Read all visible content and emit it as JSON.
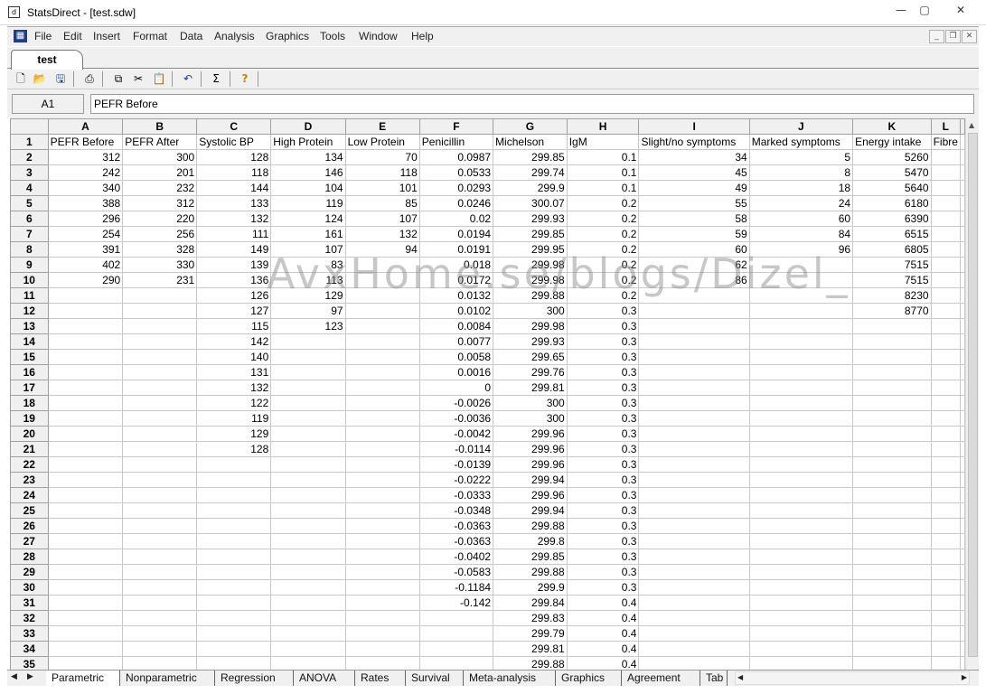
{
  "window": {
    "title": "StatsDirect - [test.sdw]",
    "minimize": "—",
    "maximize": "▢",
    "close": "✕"
  },
  "menu": {
    "items": [
      "File",
      "Edit",
      "Insert",
      "Format",
      "Data",
      "Analysis",
      "Graphics",
      "Tools",
      "Window",
      "Help"
    ]
  },
  "doc_tab": "test",
  "formula": {
    "cell_ref": "A1",
    "content": "PEFR Before"
  },
  "grid": {
    "columns": [
      "A",
      "B",
      "C",
      "D",
      "E",
      "F",
      "G",
      "H",
      "I",
      "J",
      "K",
      "L"
    ],
    "headers": [
      "PEFR Before",
      "PEFR After",
      "Systolic BP",
      "High Protein",
      "Low Protein",
      "Penicillin",
      "Michelson",
      "IgM",
      "Slight/no symptoms",
      "Marked symptoms",
      "Energy intake",
      "Fibre"
    ],
    "rows": [
      [
        "312",
        "300",
        "128",
        "134",
        "70",
        "0.0987",
        "299.85",
        "0.1",
        "34",
        "5",
        "5260",
        ""
      ],
      [
        "242",
        "201",
        "118",
        "146",
        "118",
        "0.0533",
        "299.74",
        "0.1",
        "45",
        "8",
        "5470",
        ""
      ],
      [
        "340",
        "232",
        "144",
        "104",
        "101",
        "0.0293",
        "299.9",
        "0.1",
        "49",
        "18",
        "5640",
        ""
      ],
      [
        "388",
        "312",
        "133",
        "119",
        "85",
        "0.0246",
        "300.07",
        "0.2",
        "55",
        "24",
        "6180",
        ""
      ],
      [
        "296",
        "220",
        "132",
        "124",
        "107",
        "0.02",
        "299.93",
        "0.2",
        "58",
        "60",
        "6390",
        ""
      ],
      [
        "254",
        "256",
        "111",
        "161",
        "132",
        "0.0194",
        "299.85",
        "0.2",
        "59",
        "84",
        "6515",
        ""
      ],
      [
        "391",
        "328",
        "149",
        "107",
        "94",
        "0.0191",
        "299.95",
        "0.2",
        "60",
        "96",
        "6805",
        ""
      ],
      [
        "402",
        "330",
        "139",
        "83",
        "",
        "0.018",
        "299.98",
        "0.2",
        "62",
        "",
        "7515",
        ""
      ],
      [
        "290",
        "231",
        "136",
        "113",
        "",
        "0.0172",
        "299.98",
        "0.2",
        "86",
        "",
        "7515",
        ""
      ],
      [
        "",
        "",
        "126",
        "129",
        "",
        "0.0132",
        "299.88",
        "0.2",
        "",
        "",
        "8230",
        ""
      ],
      [
        "",
        "",
        "127",
        "97",
        "",
        "0.0102",
        "300",
        "0.3",
        "",
        "",
        "8770",
        ""
      ],
      [
        "",
        "",
        "115",
        "123",
        "",
        "0.0084",
        "299.98",
        "0.3",
        "",
        "",
        "",
        ""
      ],
      [
        "",
        "",
        "142",
        "",
        "",
        "0.0077",
        "299.93",
        "0.3",
        "",
        "",
        "",
        ""
      ],
      [
        "",
        "",
        "140",
        "",
        "",
        "0.0058",
        "299.65",
        "0.3",
        "",
        "",
        "",
        ""
      ],
      [
        "",
        "",
        "131",
        "",
        "",
        "0.0016",
        "299.76",
        "0.3",
        "",
        "",
        "",
        ""
      ],
      [
        "",
        "",
        "132",
        "",
        "",
        "0",
        "299.81",
        "0.3",
        "",
        "",
        "",
        ""
      ],
      [
        "",
        "",
        "122",
        "",
        "",
        "-0.0026",
        "300",
        "0.3",
        "",
        "",
        "",
        ""
      ],
      [
        "",
        "",
        "119",
        "",
        "",
        "-0.0036",
        "300",
        "0.3",
        "",
        "",
        "",
        ""
      ],
      [
        "",
        "",
        "129",
        "",
        "",
        "-0.0042",
        "299.96",
        "0.3",
        "",
        "",
        "",
        ""
      ],
      [
        "",
        "",
        "128",
        "",
        "",
        "-0.0114",
        "299.96",
        "0.3",
        "",
        "",
        "",
        ""
      ],
      [
        "",
        "",
        "",
        "",
        "",
        "-0.0139",
        "299.96",
        "0.3",
        "",
        "",
        "",
        ""
      ],
      [
        "",
        "",
        "",
        "",
        "",
        "-0.0222",
        "299.94",
        "0.3",
        "",
        "",
        "",
        ""
      ],
      [
        "",
        "",
        "",
        "",
        "",
        "-0.0333",
        "299.96",
        "0.3",
        "",
        "",
        "",
        ""
      ],
      [
        "",
        "",
        "",
        "",
        "",
        "-0.0348",
        "299.94",
        "0.3",
        "",
        "",
        "",
        ""
      ],
      [
        "",
        "",
        "",
        "",
        "",
        "-0.0363",
        "299.88",
        "0.3",
        "",
        "",
        "",
        ""
      ],
      [
        "",
        "",
        "",
        "",
        "",
        "-0.0363",
        "299.8",
        "0.3",
        "",
        "",
        "",
        ""
      ],
      [
        "",
        "",
        "",
        "",
        "",
        "-0.0402",
        "299.85",
        "0.3",
        "",
        "",
        "",
        ""
      ],
      [
        "",
        "",
        "",
        "",
        "",
        "-0.0583",
        "299.88",
        "0.3",
        "",
        "",
        "",
        ""
      ],
      [
        "",
        "",
        "",
        "",
        "",
        "-0.1184",
        "299.9",
        "0.3",
        "",
        "",
        "",
        ""
      ],
      [
        "",
        "",
        "",
        "",
        "",
        "-0.142",
        "299.84",
        "0.4",
        "",
        "",
        "",
        ""
      ],
      [
        "",
        "",
        "",
        "",
        "",
        "",
        "299.83",
        "0.4",
        "",
        "",
        "",
        ""
      ],
      [
        "",
        "",
        "",
        "",
        "",
        "",
        "299.79",
        "0.4",
        "",
        "",
        "",
        ""
      ],
      [
        "",
        "",
        "",
        "",
        "",
        "",
        "299.81",
        "0.4",
        "",
        "",
        "",
        ""
      ],
      [
        "",
        "",
        "",
        "",
        "",
        "",
        "299.88",
        "0.4",
        "",
        "",
        "",
        ""
      ]
    ]
  },
  "sheet_tabs": [
    "Parametric",
    "Nonparametric",
    "Regression",
    "ANOVA",
    "Rates",
    "Survival",
    "Meta-analysis",
    "Graphics",
    "Agreement",
    "Tab"
  ],
  "active_sheet": "Parametric",
  "watermark": "AvxHome.se/blogs/Dizel_",
  "colors": {
    "menu_icon": "#1c3e8c",
    "header_bg": "#f0f0f0",
    "grid_line": "#c8c8c8"
  }
}
